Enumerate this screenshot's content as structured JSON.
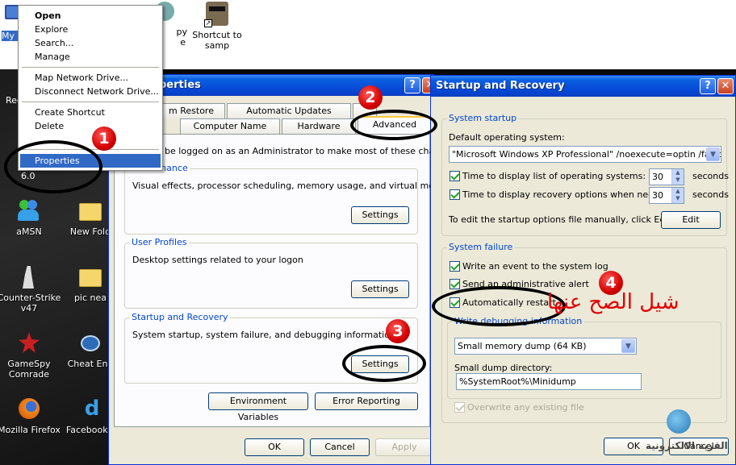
{
  "desktop": {
    "icons": {
      "my_computer": "My Co",
      "shortcut_samp": "Shortcut to\nsamp",
      "recycle": "Recy",
      "version": "6.0",
      "amsn": "aMSN",
      "new_folder": "New Fold",
      "counter_strike": "Counter-Strike\nv47",
      "pic_folder": "pic nea",
      "gamespy": "GameSpy\nComrade",
      "cheat_engine": "Cheat Eng",
      "firefox": "Mozilla Firefox",
      "facebook": "FacebookD",
      "partial_py": "py",
      "partial_e": "e"
    }
  },
  "context_menu": {
    "open": "Open",
    "explore": "Explore",
    "search": "Search...",
    "manage": "Manage",
    "map_drive": "Map Network Drive...",
    "disconnect_drive": "Disconnect Network Drive...",
    "create_shortcut": "Create Shortcut",
    "delete": "Delete",
    "properties": "Properties"
  },
  "system_properties": {
    "title": "perties",
    "tabs": {
      "restore": "m Restore",
      "automatic_updates": "Automatic Updates",
      "computer_name": "Computer Name",
      "hardware": "Hardware",
      "advanced": "Advanced"
    },
    "admin_note": "be logged on as an Administrator to make most of these changes.",
    "performance": {
      "label": "Performance",
      "description": "Visual effects, processor scheduling, memory usage, and virtual memory",
      "settings": "Settings"
    },
    "user_profiles": {
      "label": "User Profiles",
      "description": "Desktop settings related to your logon",
      "settings": "Settings"
    },
    "startup_recovery": {
      "label": "Startup and Recovery",
      "description": "System startup, system failure, and debugging information",
      "settings": "Settings"
    },
    "environment_variables": "Environment Variables",
    "error_reporting": "Error Reporting",
    "ok": "OK",
    "cancel": "Cancel",
    "apply": "Apply"
  },
  "startup_recovery": {
    "title": "Startup and Recovery",
    "system_startup": {
      "label": "System startup",
      "default_os_label": "Default operating system:",
      "default_os_value": "\"Microsoft Windows XP Professional\" /noexecute=optin /fastdete",
      "time_list_label": "Time to display list of operating systems:",
      "time_list_value": "30",
      "time_recovery_label": "Time to display recovery options when needed:",
      "time_recovery_value": "30",
      "seconds": "seconds",
      "edit_note": "To edit the startup options file manually, click Edit.",
      "edit": "Edit"
    },
    "system_failure": {
      "label": "System failure",
      "write_event": "Write an event to the system log",
      "send_alert": "Send an administrative alert",
      "auto_restart": "Automatically restart",
      "write_debug_label": "Write debugging information",
      "dump_type": "Small memory dump (64 KB)",
      "dump_dir_label": "Small dump directory:",
      "dump_dir_value": "%SystemRoot%\\Minidump",
      "overwrite": "Overwrite any existing file"
    },
    "ok": "OK",
    "cancel": "Cancel"
  },
  "annotations": {
    "step1": "1",
    "step2": "2",
    "step3": "3",
    "step4": "4",
    "arabic_note": "شيل الصح عنها",
    "watermark": "القرية الالكترونية"
  },
  "colors": {
    "title_blue": "#0648d6",
    "group_label_blue": "#0046d5",
    "highlight": "#316ac5",
    "annotation_red": "#d40000"
  }
}
